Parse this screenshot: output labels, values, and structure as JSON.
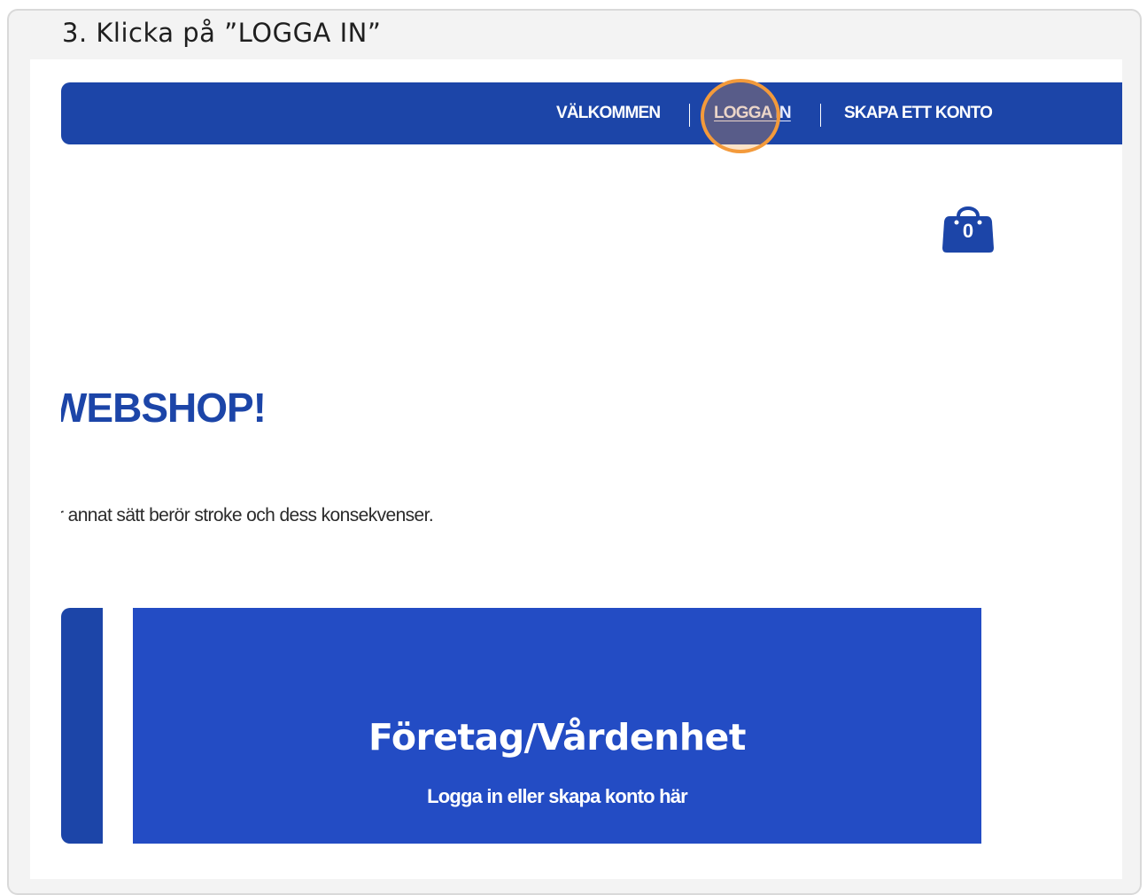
{
  "caption": "3. Klicka på ”LOGGA IN”",
  "nav": {
    "welcome": "VÄLKOMMEN",
    "login": "LOGGA IN",
    "create_account": "SKAPA ETT KONTO"
  },
  "cart": {
    "count": "0",
    "icon": "shopping-bag-icon"
  },
  "hero": {
    "title": "WEBSHOP!",
    "text": "r annat sätt berör stroke och dess konsekvenser."
  },
  "panel": {
    "title": "Företag/Vårdenhet",
    "subtitle": "Logga in eller skapa konto här"
  },
  "colors": {
    "brand_blue": "#1c45a8",
    "panel_blue": "#234cc4",
    "highlight": "#f39a3b"
  }
}
